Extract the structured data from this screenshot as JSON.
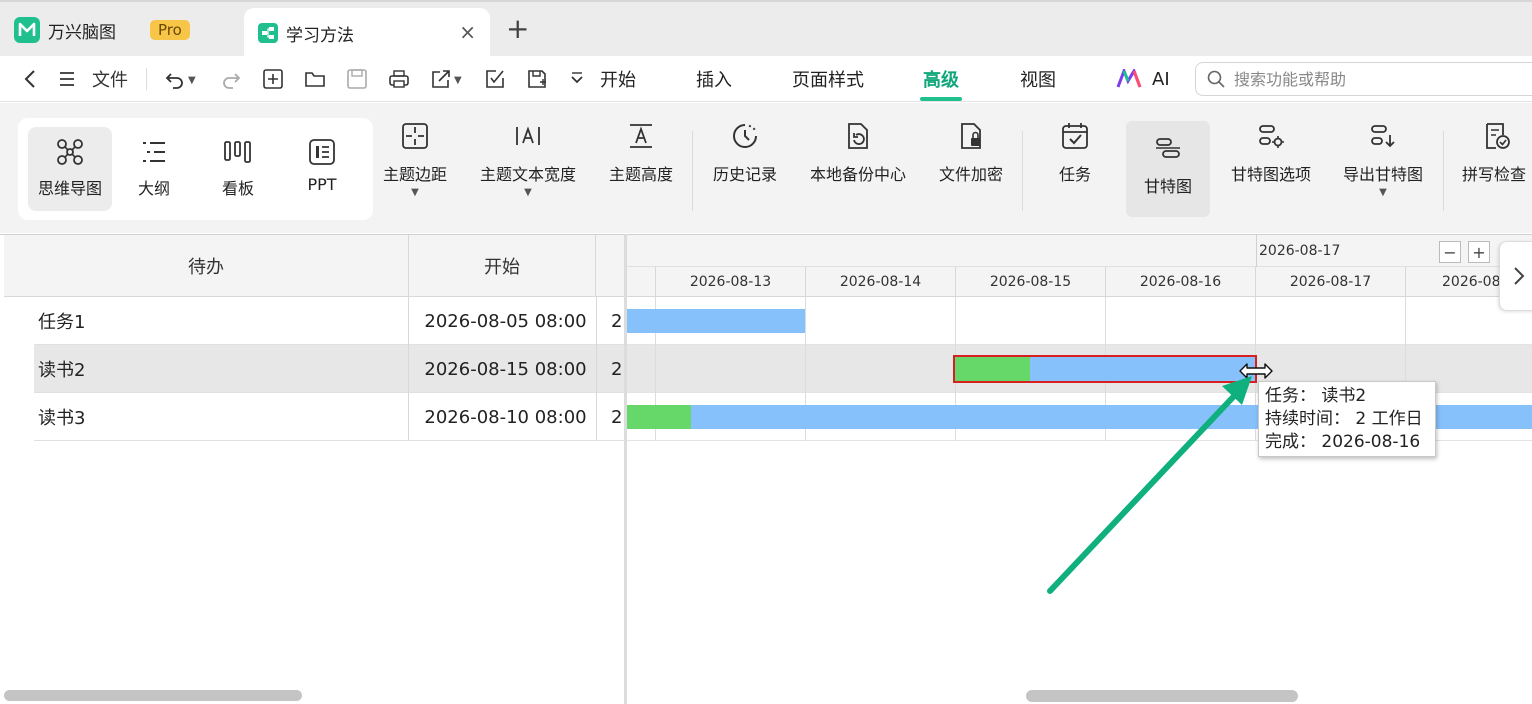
{
  "tabs": {
    "app_name": "万兴脑图",
    "pro_badge": "Pro",
    "doc_name": "学习方法",
    "close_glyph": "×",
    "new_tab_glyph": "+"
  },
  "menubar": {
    "file_label": "文件",
    "tabs": [
      "开始",
      "插入",
      "页面样式",
      "高级",
      "视图"
    ],
    "active_tab": "高级",
    "ai_label": "AI",
    "search_placeholder": "搜索功能或帮助"
  },
  "ribbon": {
    "views": [
      "思维导图",
      "大纲",
      "看板",
      "PPT"
    ],
    "active_view": "思维导图",
    "tools": [
      "主题边距",
      "主题文本宽度",
      "主题高度",
      "历史记录",
      "本地备份中心",
      "文件加密",
      "任务",
      "甘特图",
      "甘特图选项",
      "导出甘特图",
      "拼写检查"
    ],
    "pressed_tool": "甘特图"
  },
  "table": {
    "headers": [
      "待办",
      "开始"
    ],
    "rows": [
      {
        "name": "任务1",
        "start": "2026-08-05 08:00",
        "trunc": "2"
      },
      {
        "name": "读书2",
        "start": "2026-08-15 08:00",
        "trunc": "2"
      },
      {
        "name": "读书3",
        "start": "2026-08-10 08:00",
        "trunc": "2"
      }
    ],
    "highlighted_row": 1
  },
  "gantt": {
    "top_label": "2026-08-17",
    "zoom_out": "−",
    "zoom_in": "+",
    "dates": [
      "2026-08-13",
      "2026-08-14",
      "2026-08-15",
      "2026-08-16",
      "2026-08-17",
      "2026-08"
    ],
    "bars": [
      {
        "task": "任务1",
        "start_day": 12.8,
        "end_day": 14.0,
        "progress": 0.0
      },
      {
        "task": "读书2",
        "start_day": 15.0,
        "end_day": 17.0,
        "progress": 0.25,
        "selected": true
      },
      {
        "task": "读书3",
        "start_day": 12.8,
        "end_day": 18.9,
        "progress": 0.07
      }
    ],
    "tooltip": {
      "task_label": "任务：",
      "task_value": "读书2",
      "duration_label": "持续时间：",
      "duration_value": "2 工作日",
      "finish_label": "完成：",
      "finish_value": "2026-08-16"
    }
  },
  "colors": {
    "accent": "#1fc08e",
    "bar": "#86c1fb",
    "progress": "#66d86a",
    "selection": "#d92020",
    "annotation_arrow": "#10b07e"
  }
}
